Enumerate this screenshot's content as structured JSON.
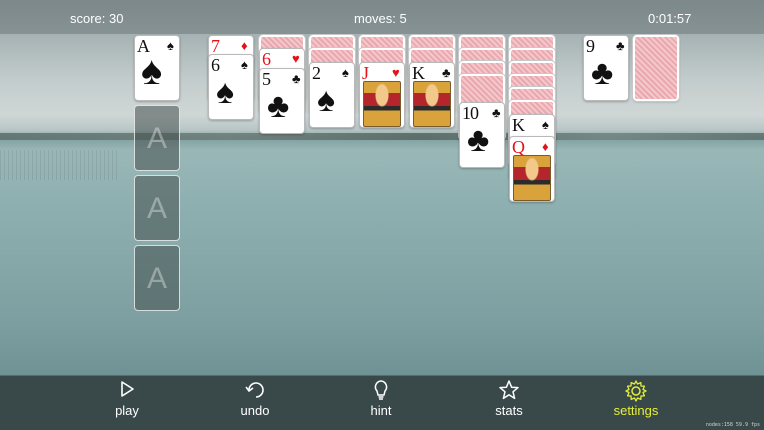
{
  "header": {
    "score": "score: 30",
    "moves": "moves: 5",
    "timer": "0:01:57"
  },
  "foundations": {
    "spade": {
      "rank": "A",
      "suit": "♠"
    },
    "empty_label": "A"
  },
  "tableau": {
    "col1": {
      "card1": {
        "rank": "7",
        "suit": "♦"
      },
      "card2": {
        "rank": "6",
        "suit": "♠"
      }
    },
    "col2": {
      "card1": {
        "rank": "6",
        "suit": "♥"
      },
      "card2": {
        "rank": "5",
        "suit": "♣"
      }
    },
    "col3": {
      "card1": {
        "rank": "2",
        "suit": "♠"
      }
    },
    "col4": {
      "card1": {
        "rank": "J",
        "suit": "♥"
      }
    },
    "col5": {
      "card1": {
        "rank": "K",
        "suit": "♣"
      }
    },
    "col6": {
      "card1": {
        "rank": "10",
        "suit": "♣"
      }
    },
    "col7": {
      "card1": {
        "rank": "K",
        "suit": "♠"
      },
      "card2": {
        "rank": "Q",
        "suit": "♦"
      }
    }
  },
  "waste": {
    "rank": "9",
    "suit": "♣"
  },
  "toolbar": {
    "play": {
      "label": "play",
      "icon": "play-icon"
    },
    "undo": {
      "label": "undo",
      "icon": "undo-icon"
    },
    "hint": {
      "label": "hint",
      "icon": "lightbulb-icon"
    },
    "stats": {
      "label": "stats",
      "icon": "star-icon"
    },
    "settings": {
      "label": "settings",
      "icon": "gear-icon",
      "color": "#e4ef3a"
    }
  },
  "debug_text": "nodes:158 59.9 fps"
}
